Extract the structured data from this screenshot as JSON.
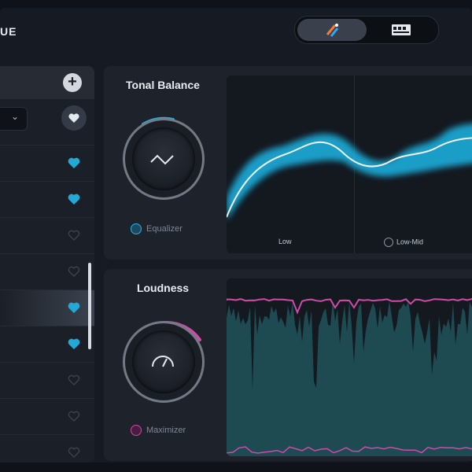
{
  "app": {
    "logo": "UE"
  },
  "sidebar": {
    "dropdown_glyph": "⌄",
    "add_glyph": "+",
    "items": [
      {
        "favorite": true
      },
      {
        "favorite": true
      },
      {
        "favorite": false
      },
      {
        "favorite": false
      },
      {
        "favorite": true,
        "selected": true
      },
      {
        "favorite": true
      },
      {
        "favorite": false
      },
      {
        "favorite": false
      },
      {
        "favorite": false
      }
    ]
  },
  "tonal_balance": {
    "title": "Tonal Balance",
    "module_label": "Equalizer",
    "bands": [
      "Low",
      "Low-Mid"
    ],
    "accent": "#1fb6e6"
  },
  "loudness": {
    "title": "Loudness",
    "module_label": "Maximizer",
    "accent": "#d04aa8"
  },
  "icons": {
    "heart_filled_color": "#22a9d6",
    "heart_empty_color": "#3a404b"
  }
}
